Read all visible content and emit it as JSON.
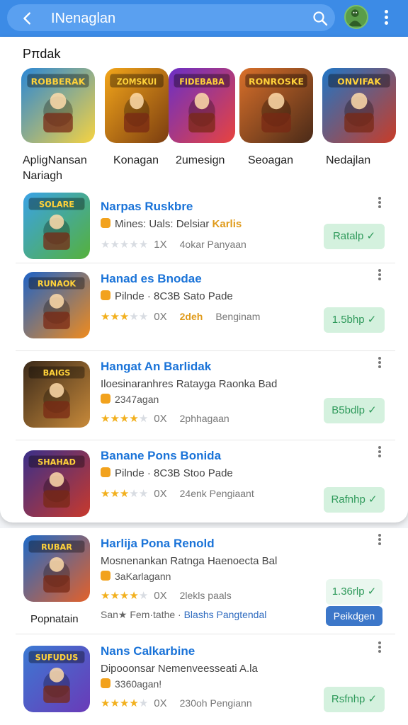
{
  "topbar": {
    "search_value": "INenaglan",
    "back_icon": "back-arrow-icon",
    "search_icon": "search-icon",
    "menu_icon": "more-vertical-icon"
  },
  "section": {
    "title": "Pπdak"
  },
  "featured": [
    {
      "label": "ApligNansan\nNariagh",
      "art": "ROBBERAK",
      "colors": [
        "#2a87d6",
        "#f6d341"
      ]
    },
    {
      "label": "Konagan",
      "art": "ZOMSKUI",
      "colors": [
        "#f3a61a",
        "#7b3d10"
      ]
    },
    {
      "label": "2umesign",
      "art": "FIDEBABA",
      "colors": [
        "#6a2fc7",
        "#e8433e"
      ]
    },
    {
      "label": "Seoagan",
      "art": "RONROSKE",
      "colors": [
        "#d9702a",
        "#4a2a18"
      ]
    },
    {
      "label": "Nedajlan",
      "art": "ONVIFAK",
      "colors": [
        "#1f76c7",
        "#c93c27"
      ]
    }
  ],
  "apps": [
    {
      "title": "Narpas Ruskbre",
      "sub": "Mines: Uals: Delsiar",
      "sub_gold": "Karlis",
      "stars": 0,
      "rating": "1X",
      "meta": "4okar Panyaan",
      "install": "Ratalp ✓",
      "art": "SOLARE",
      "colors": [
        "#3aa2e6",
        "#55b13b"
      ]
    },
    {
      "title": "Hanad es Bnodae",
      "sub": "Pilnde · 8C3B Sato Pade",
      "stars": 3,
      "rating": "0X",
      "meta_gold": "2deh",
      "meta": "Benginam",
      "install": "1.5bhp ✓",
      "art": "RUNAOK",
      "colors": [
        "#1e63c7",
        "#f08b1d"
      ]
    },
    {
      "title": "Hangat An Barlidak",
      "sub": "Iloesinaranhres Ratayga Raonka Bad",
      "sub2": "2347agan",
      "stars": 4,
      "rating": "0X",
      "meta": "2phhagaan",
      "install": "B5bdlp ✓",
      "art": "BAIGS",
      "colors": [
        "#3b2a1a",
        "#c88a3a"
      ]
    },
    {
      "title": "Banane Pons Bonida",
      "sub": "Pilnde · 8C3B Stoo Pade",
      "stars": 3,
      "rating": "0X",
      "meta": "24enk Pengiaant",
      "install": "Rafnhp ✓",
      "art": "SHAHAD",
      "colors": [
        "#3a2f8a",
        "#c8392c"
      ]
    }
  ],
  "below_apps": [
    {
      "title": "Harlija Pona Renold",
      "sub": "Mosnenankan Ratnga Haenoecta Bal",
      "sub2": "3aKarlagann",
      "stars": 4,
      "rating": "0X",
      "meta": "2lekls paals",
      "install": "1.36rlp ✓",
      "under_label": "Popnatain",
      "promo_grey": "San★ Fem·tathe ·",
      "promo_blue": "Blashs Pangtendal",
      "action": "Peikdgen",
      "art": "RUBAR",
      "colors": [
        "#1e6ac8",
        "#e3612a"
      ]
    },
    {
      "title": "Nans Calkarbine",
      "sub": "Dipooonsar Nemenveesseati A.la",
      "sub2": "3360agan!",
      "stars": 4,
      "rating": "0X",
      "meta": "230oh Pengiann",
      "install": "Rsfnhp ✓",
      "art": "SUFUDUS",
      "colors": [
        "#3b7ad3",
        "#6a3ab8"
      ]
    }
  ]
}
